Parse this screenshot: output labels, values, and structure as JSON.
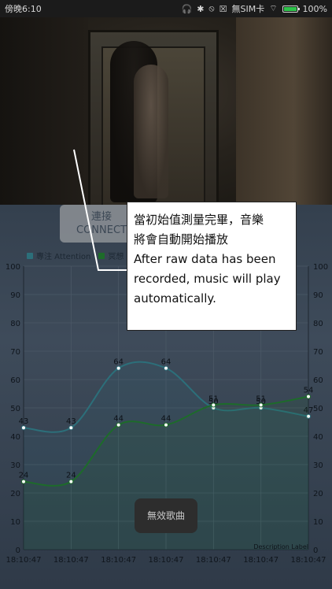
{
  "statusbar": {
    "time": "傍晚6:10",
    "network": "無SIM卡",
    "battery_pct": "100%",
    "battery_fill": 1.0,
    "icons": [
      "headphone-icon",
      "bluetooth-icon",
      "mute-icon",
      "sim-icon"
    ]
  },
  "connect_button": {
    "line1": "連接",
    "line2": "CONNECT"
  },
  "legend": {
    "attention": "專注 Attention",
    "meditation": "冥想 Meditation"
  },
  "colors": {
    "attention": "#2c6f7a",
    "meditation": "#1d6b2a",
    "grid": "#4b5866"
  },
  "chart_data": {
    "type": "line",
    "x": [
      "18:10:47",
      "18:10:47",
      "18:10:47",
      "18:10:47",
      "18:10:47",
      "18:10:47",
      "18:10:47"
    ],
    "series": [
      {
        "name": "專注 Attention",
        "values": [
          43,
          43,
          64,
          64,
          50,
          50,
          47
        ]
      },
      {
        "name": "冥想 Meditation",
        "values": [
          24,
          24,
          44,
          44,
          51,
          51,
          54
        ]
      }
    ],
    "ylim": [
      0,
      100
    ],
    "yticks": [
      0,
      10,
      20,
      30,
      40,
      50,
      60,
      70,
      80,
      90,
      100
    ],
    "xlabel": "",
    "ylabel": "",
    "grid": true,
    "legend_position": "top-left"
  },
  "toast": "無效歌曲",
  "description_label": "Description Label",
  "annotation": {
    "zh_line1": "當初始值測量完畢，音樂",
    "zh_line2": "將會自動開始播放",
    "en_line1": "After raw data has been",
    "en_line2": "recorded, music will play",
    "en_line3": "automatically."
  }
}
